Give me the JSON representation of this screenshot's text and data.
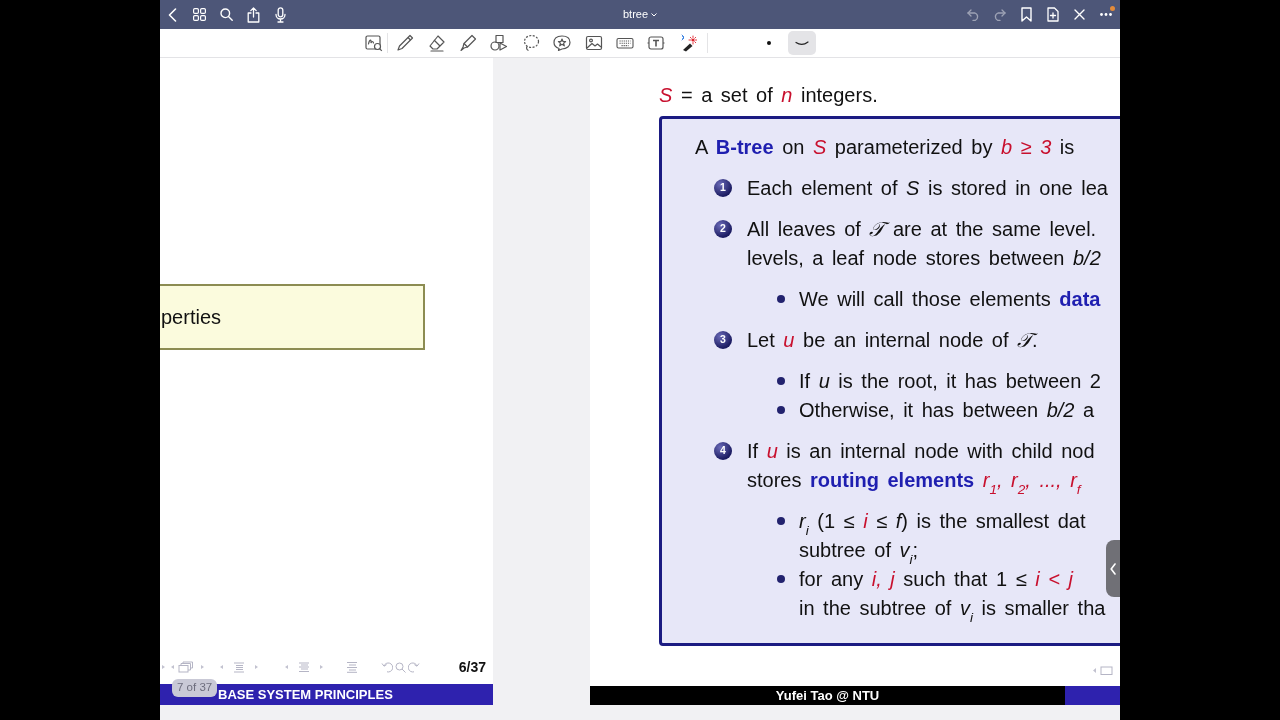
{
  "app_bar": {
    "title": "btree",
    "undo": {
      "disabled": true
    },
    "redo": {
      "disabled": true
    },
    "more": {
      "alert": true
    }
  },
  "toolbar": {
    "stroke_options": [
      {
        "kind": "dot",
        "selected": false
      },
      {
        "kind": "curve",
        "selected": true
      }
    ]
  },
  "left_page": {
    "callout": "perties",
    "frame_counter": "6/37",
    "footer": "BASE SYSTEM PRINCIPLES",
    "page_indicator": "7 of 37"
  },
  "right_page": {
    "intro": [
      {
        "kind": "highlight",
        "text": "S"
      },
      {
        "kind": "text",
        "text": " = a set of "
      },
      {
        "kind": "highlight",
        "text": "n"
      },
      {
        "kind": "text",
        "text": " integers."
      }
    ],
    "definition": {
      "heading": [
        {
          "kind": "text",
          "text": "A "
        },
        {
          "kind": "term",
          "text": "B-tree"
        },
        {
          "kind": "text",
          "text": " on "
        },
        {
          "kind": "highlight",
          "text": "S"
        },
        {
          "kind": "text",
          "text": " parameterized by "
        },
        {
          "kind": "highlight",
          "text": "b ≥ 3"
        },
        {
          "kind": "text",
          "text": " is"
        }
      ],
      "items": [
        {
          "number": "1",
          "lines": [
            [
              {
                "kind": "text",
                "text": "Each element of "
              },
              {
                "kind": "math",
                "text": "S"
              },
              {
                "kind": "text",
                "text": " is stored in one lea"
              }
            ]
          ]
        },
        {
          "number": "2",
          "lines": [
            [
              {
                "kind": "text",
                "text": "All leaves of "
              },
              {
                "kind": "math",
                "text": "𝒯"
              },
              {
                "kind": "text",
                "text": " are at the same level."
              }
            ],
            [
              {
                "kind": "text",
                "text": "levels, a leaf node stores between "
              },
              {
                "kind": "math",
                "text": "b/2"
              }
            ]
          ],
          "bullets": [
            {
              "lines": [
                [
                  {
                    "kind": "text",
                    "text": "We will call those elements "
                  },
                  {
                    "kind": "term",
                    "text": "data"
                  }
                ]
              ]
            }
          ]
        },
        {
          "number": "3",
          "lines": [
            [
              {
                "kind": "text",
                "text": "Let "
              },
              {
                "kind": "highlight",
                "text": "u"
              },
              {
                "kind": "text",
                "text": " be an internal node of "
              },
              {
                "kind": "math",
                "text": "𝒯"
              },
              {
                "kind": "text",
                "text": "."
              }
            ]
          ],
          "bullets": [
            {
              "lines": [
                [
                  {
                    "kind": "text",
                    "text": "If "
                  },
                  {
                    "kind": "math",
                    "text": "u"
                  },
                  {
                    "kind": "text",
                    "text": " is the root, it has between 2"
                  }
                ]
              ]
            },
            {
              "lines": [
                [
                  {
                    "kind": "text",
                    "text": "Otherwise, it has between "
                  },
                  {
                    "kind": "math",
                    "text": "b/2"
                  },
                  {
                    "kind": "text",
                    "text": " a"
                  }
                ]
              ]
            }
          ]
        },
        {
          "number": "4",
          "lines": [
            [
              {
                "kind": "text",
                "text": "If "
              },
              {
                "kind": "highlight",
                "text": "u"
              },
              {
                "kind": "text",
                "text": " is an internal node with child nod"
              }
            ],
            [
              {
                "kind": "text",
                "text": "stores "
              },
              {
                "kind": "term",
                "text": "routing elements"
              },
              {
                "kind": "highlight",
                "text": " r$_{1}$, r$_{2}$, ..., r$_{f}$"
              }
            ]
          ],
          "bullets": [
            {
              "lines": [
                [
                  {
                    "kind": "math",
                    "text": "r$_{i}$"
                  },
                  {
                    "kind": "text",
                    "text": " (1 ≤ "
                  },
                  {
                    "kind": "highlight",
                    "text": "i"
                  },
                  {
                    "kind": "text",
                    "text": " ≤ "
                  },
                  {
                    "kind": "math",
                    "text": "f"
                  },
                  {
                    "kind": "text",
                    "text": ") is the smallest dat"
                  }
                ],
                [
                  {
                    "kind": "text",
                    "text": "subtree of "
                  },
                  {
                    "kind": "math",
                    "text": "v$_{i}$"
                  },
                  {
                    "kind": "text",
                    "text": ";"
                  }
                ]
              ]
            },
            {
              "lines": [
                [
                  {
                    "kind": "text",
                    "text": "for any "
                  },
                  {
                    "kind": "highlight",
                    "text": "i, j"
                  },
                  {
                    "kind": "text",
                    "text": " such that 1 ≤ "
                  },
                  {
                    "kind": "highlight",
                    "text": "i < j"
                  }
                ],
                [
                  {
                    "kind": "text",
                    "text": "in the subtree of "
                  },
                  {
                    "kind": "math",
                    "text": "v$_{i}$"
                  },
                  {
                    "kind": "text",
                    "text": " is smaller tha"
                  }
                ]
              ]
            }
          ]
        }
      ]
    },
    "footer": "Yufei Tao @ NTU"
  }
}
